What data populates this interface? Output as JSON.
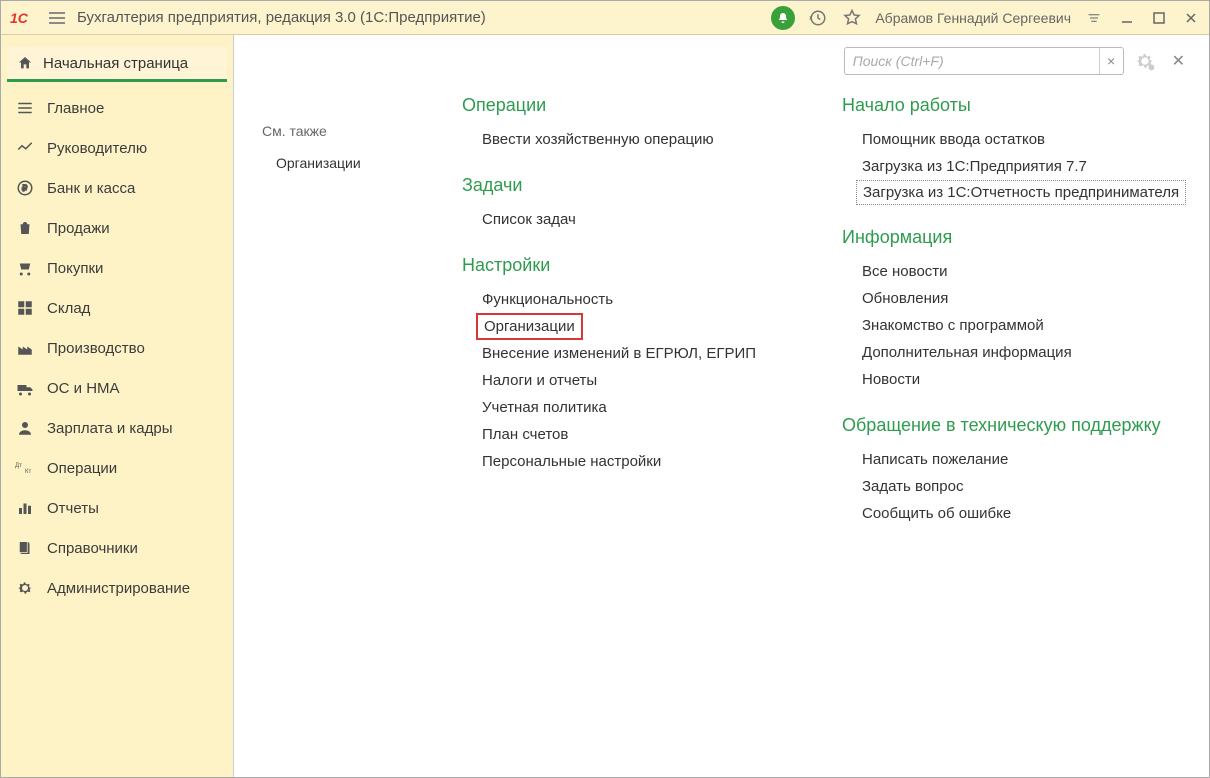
{
  "titlebar": {
    "title": "Бухгалтерия предприятия, редакция 3.0  (1С:Предприятие)",
    "user": "Абрамов Геннадий Сергеевич"
  },
  "home_tab": "Начальная страница",
  "sidebar": {
    "items": [
      {
        "label": "Главное",
        "icon": "menu"
      },
      {
        "label": "Руководителю",
        "icon": "chart"
      },
      {
        "label": "Банк и касса",
        "icon": "ruble"
      },
      {
        "label": "Продажи",
        "icon": "bag"
      },
      {
        "label": "Покупки",
        "icon": "cart"
      },
      {
        "label": "Склад",
        "icon": "boxes"
      },
      {
        "label": "Производство",
        "icon": "factory"
      },
      {
        "label": "ОС и НМА",
        "icon": "truck"
      },
      {
        "label": "Зарплата и кадры",
        "icon": "person"
      },
      {
        "label": "Операции",
        "icon": "dtk"
      },
      {
        "label": "Отчеты",
        "icon": "bars"
      },
      {
        "label": "Справочники",
        "icon": "book"
      },
      {
        "label": "Администрирование",
        "icon": "gear"
      }
    ]
  },
  "search": {
    "placeholder": "Поиск (Ctrl+F)"
  },
  "aside": {
    "head": "См. также",
    "items": [
      "Организации"
    ]
  },
  "col_middle": [
    {
      "head": "Операции",
      "items": [
        "Ввести хозяйственную операцию"
      ]
    },
    {
      "head": "Задачи",
      "items": [
        "Список задач"
      ]
    },
    {
      "head": "Настройки",
      "items": [
        "Функциональность",
        "Организации",
        "Внесение изменений в ЕГРЮЛ, ЕГРИП",
        "Налоги и отчеты",
        "Учетная политика",
        "План счетов",
        "Персональные настройки"
      ]
    }
  ],
  "col_right": [
    {
      "head": "Начало работы",
      "items": [
        "Помощник ввода остатков",
        "Загрузка из 1С:Предприятия 7.7",
        "Загрузка из 1С:Отчетность предпринимателя"
      ]
    },
    {
      "head": "Информация",
      "items": [
        "Все новости",
        "Обновления",
        "Знакомство с программой",
        "Дополнительная информация",
        "Новости"
      ]
    },
    {
      "head": "Обращение в техническую поддержку",
      "items": [
        "Написать пожелание",
        "Задать вопрос",
        "Сообщить об ошибке"
      ]
    }
  ]
}
